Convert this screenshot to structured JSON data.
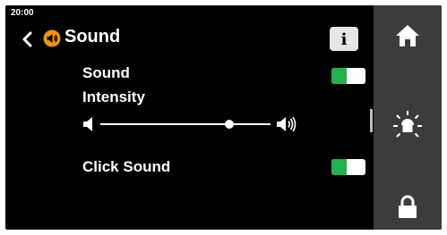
{
  "status": {
    "time": "20:00"
  },
  "header": {
    "title": "Sound",
    "back_icon": "chevron-left-icon",
    "section_icon": "speaker-icon",
    "section_icon_color": "#f29400",
    "info_label": "i"
  },
  "settings": {
    "sound": {
      "label": "Sound",
      "enabled": true
    },
    "intensity": {
      "label": "Intensity",
      "level_percent": 76,
      "min_icon": "volume-low-icon",
      "max_icon": "volume-high-icon"
    },
    "click_sound": {
      "label": "Click Sound",
      "enabled": true
    }
  },
  "sidebar": {
    "items": [
      {
        "name": "home",
        "icon": "home-icon"
      },
      {
        "name": "brightness",
        "icon": "sun-icon"
      },
      {
        "name": "lock",
        "icon": "lock-icon"
      }
    ]
  },
  "colors": {
    "toggle_on": "#22b14c",
    "sidebar_bg": "#3c3c3c",
    "accent": "#f29400"
  }
}
